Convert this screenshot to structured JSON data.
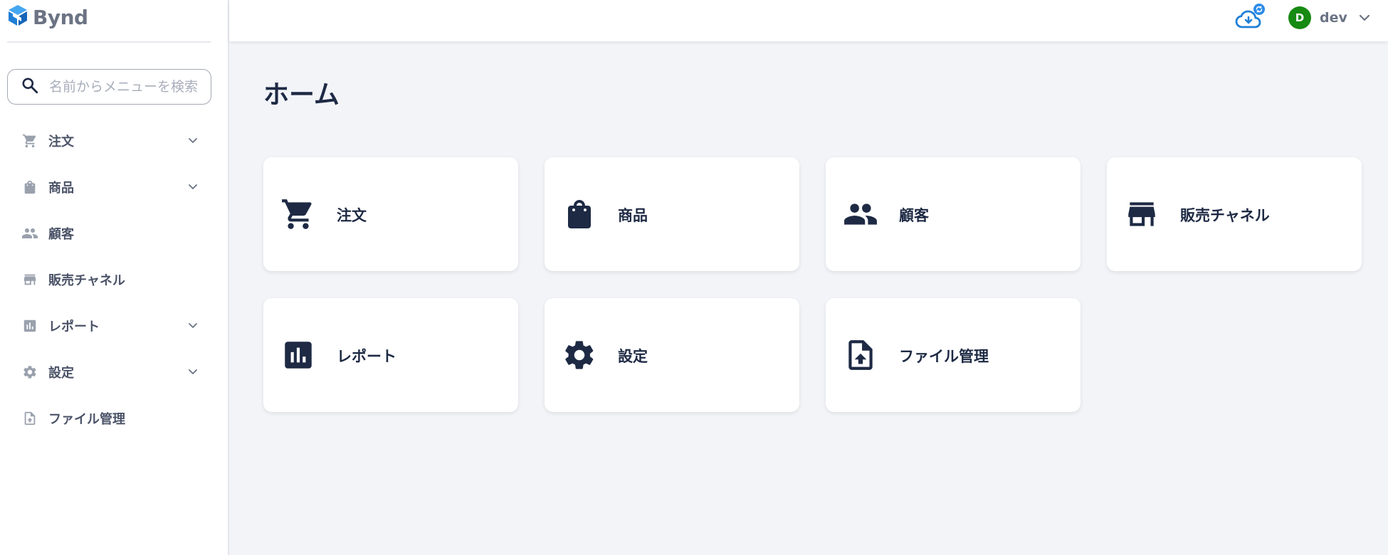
{
  "brand": {
    "name": "Bynd"
  },
  "search": {
    "placeholder": "名前からメニューを検索",
    "value": ""
  },
  "sidebar": {
    "items": [
      {
        "label": "注文",
        "icon": "cart-icon",
        "expandable": true
      },
      {
        "label": "商品",
        "icon": "shopping-bag-icon",
        "expandable": true
      },
      {
        "label": "顧客",
        "icon": "people-icon",
        "expandable": false
      },
      {
        "label": "販売チャネル",
        "icon": "storefront-icon",
        "expandable": false
      },
      {
        "label": "レポート",
        "icon": "bar-chart-icon",
        "expandable": true
      },
      {
        "label": "設定",
        "icon": "gear-icon",
        "expandable": true
      },
      {
        "label": "ファイル管理",
        "icon": "file-upload-icon",
        "expandable": false
      }
    ]
  },
  "header": {
    "sync_icon": "cloud-download-sync-icon",
    "user": {
      "initial": "D",
      "name": "dev"
    }
  },
  "main": {
    "title": "ホーム",
    "cards": [
      {
        "label": "注文",
        "icon": "cart-icon"
      },
      {
        "label": "商品",
        "icon": "shopping-bag-icon"
      },
      {
        "label": "顧客",
        "icon": "people-icon"
      },
      {
        "label": "販売チャネル",
        "icon": "storefront-icon"
      },
      {
        "label": "レポート",
        "icon": "bar-chart-icon"
      },
      {
        "label": "設定",
        "icon": "gear-icon"
      },
      {
        "label": "ファイル管理",
        "icon": "file-upload-icon"
      }
    ]
  },
  "colors": {
    "brand_blue": "#1f8fe6",
    "nav_text": "#4b5368",
    "nav_icon": "#9aa1ad",
    "card_icon": "#1e2a44",
    "avatar_green": "#168a12",
    "background": "#f2f4f8"
  }
}
